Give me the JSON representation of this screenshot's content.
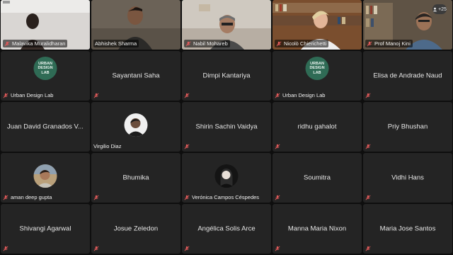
{
  "meeting": {
    "more_participants": "+25",
    "logo_text": "URBAN DESIGN LAB",
    "video_tiles": [
      {
        "name": "Malavika Muralidharan"
      },
      {
        "name": "Abhishek Sharma"
      },
      {
        "name": "Nabil Mohareb"
      },
      {
        "name": "Nicolò Chierichetti"
      },
      {
        "name": "Prof Manoj Kini"
      }
    ],
    "tiles": [
      {
        "name": "Urban Design Lab",
        "kind": "logo"
      },
      {
        "name": "Sayantani Saha",
        "kind": "center"
      },
      {
        "name": "Dimpi Kantariya",
        "kind": "center"
      },
      {
        "name": "Urban Design Lab",
        "kind": "logo"
      },
      {
        "name": "Elisa de Andrade Naud",
        "kind": "center"
      },
      {
        "name": "Juan David Granados V...",
        "kind": "center"
      },
      {
        "name": "Virgilio Diaz",
        "kind": "avatar"
      },
      {
        "name": "Shirin Sachin Vaidya",
        "kind": "center"
      },
      {
        "name": "ridhu gahalot",
        "kind": "center"
      },
      {
        "name": "Priy Bhushan",
        "kind": "center"
      },
      {
        "name": "aman deep gupta",
        "kind": "avatar"
      },
      {
        "name": "Bhumika",
        "kind": "center"
      },
      {
        "name": "Verónica Campos Céspedes",
        "kind": "avatar"
      },
      {
        "name": "Soumitra",
        "kind": "center"
      },
      {
        "name": "Vidhi Hans",
        "kind": "center"
      },
      {
        "name": "Shivangi Agarwal",
        "kind": "center"
      },
      {
        "name": "Josue Zeledon",
        "kind": "center"
      },
      {
        "name": "Angélica Solis Arce",
        "kind": "center"
      },
      {
        "name": "Manna Maria Nixon",
        "kind": "center"
      },
      {
        "name": "Maria Jose Santos",
        "kind": "center"
      }
    ]
  },
  "colors": {
    "muted_mic": "#e05a5a",
    "logo_bg": "#2f6b55",
    "tile_bg": "#242424"
  },
  "icons": {
    "mic": "muted-mic-icon",
    "more": "more-people-icon"
  }
}
